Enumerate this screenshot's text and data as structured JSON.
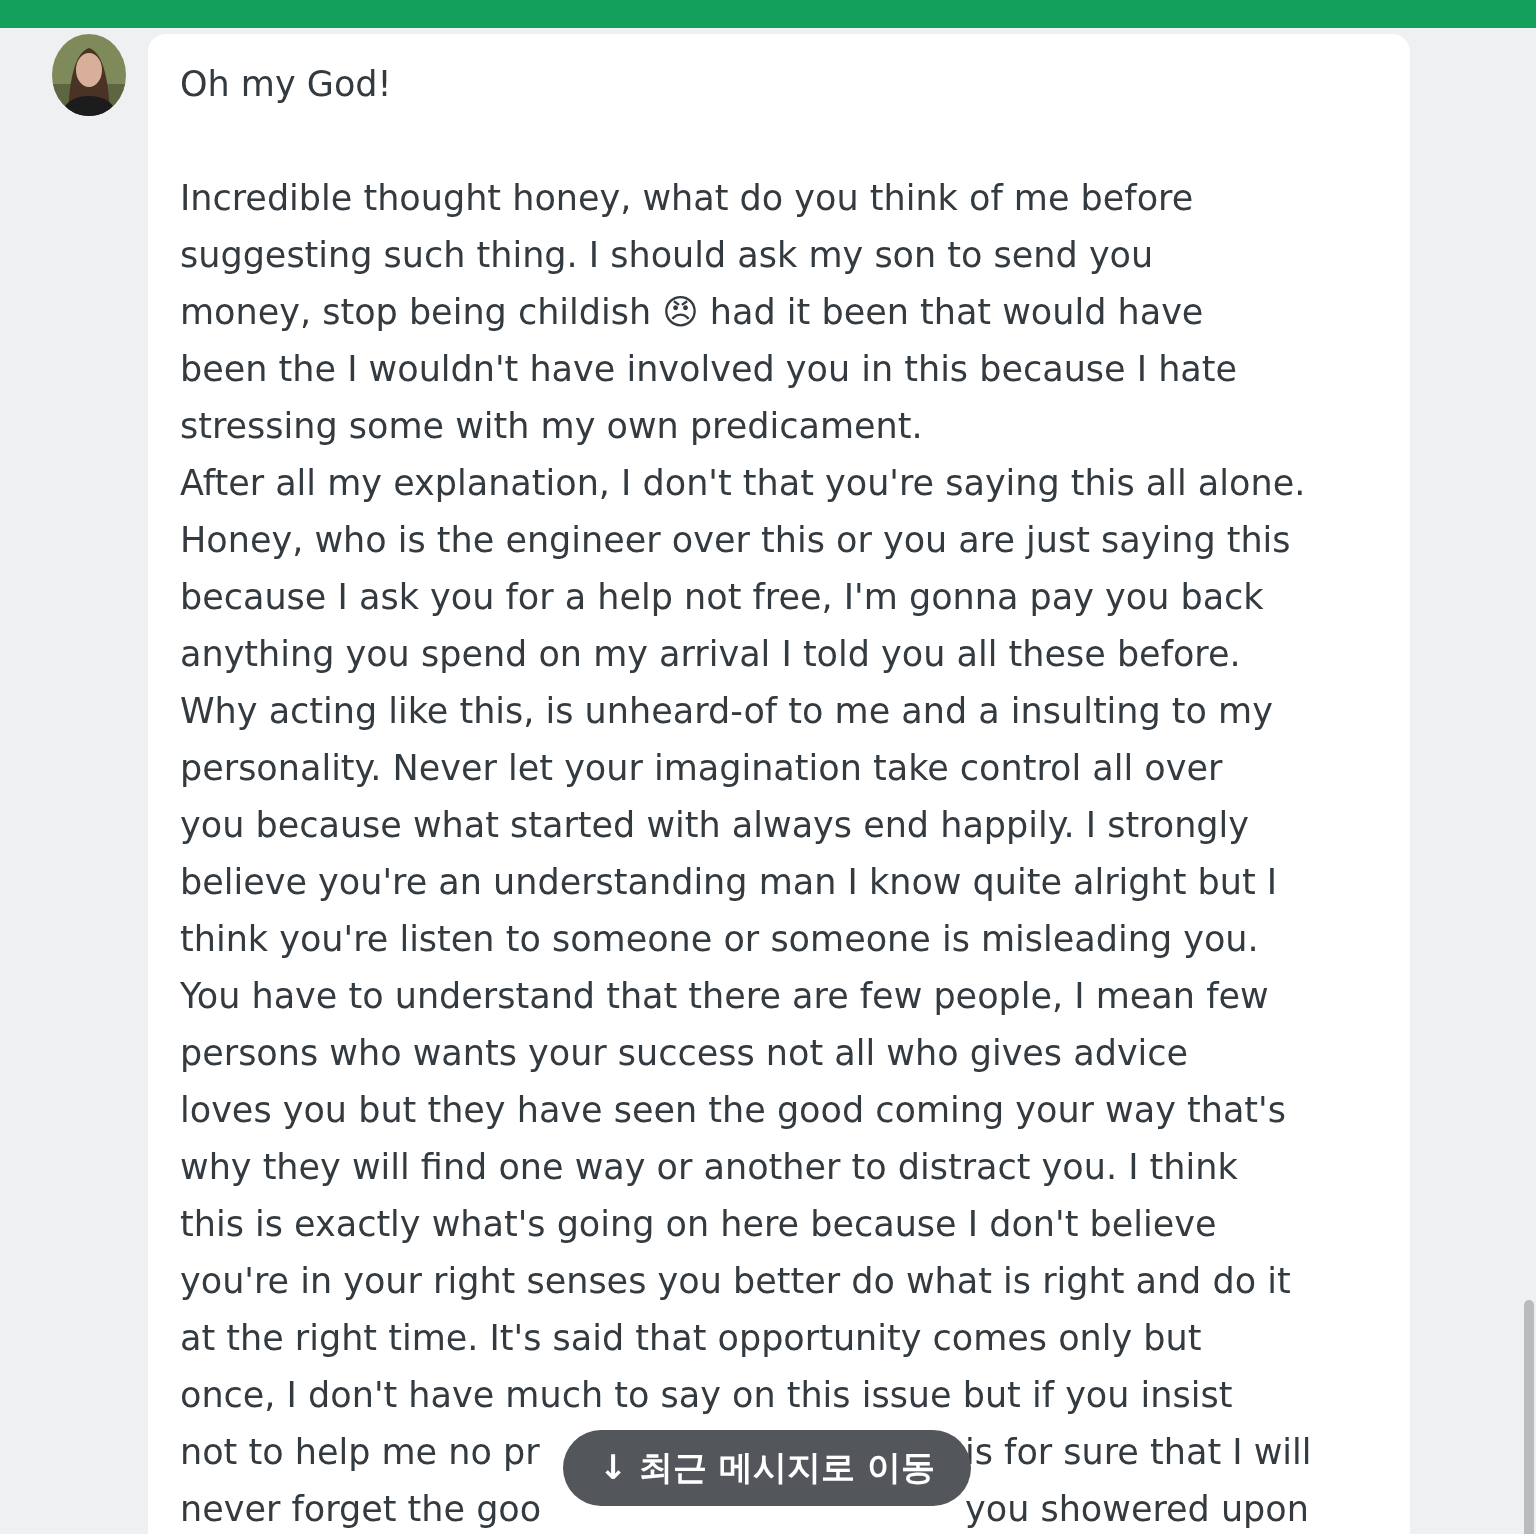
{
  "message": {
    "text": "Oh my God!\n\nIncredible thought honey, what do you think of me before\nsuggesting such thing. I should ask my son to send you\nmoney, stop being childish 😠 had it been that would have\nbeen the I wouldn't have involved you in this because I hate\nstressing some with my own predicament.\nAfter all my explanation, I don't that you're saying this all alone.\nHoney, who is the engineer over this or you are just saying this\nbecause I ask you for a help not free, I'm gonna pay you back\nanything you spend on my arrival I told you all these before.\nWhy acting like this, is unheard-of to me and a insulting to my\npersonality. Never let your imagination take control all over\nyou because what started with always end happily. I strongly\nbelieve you're an understanding man I know quite alright but I\nthink you're listen to someone or someone is misleading you.\nYou have to understand that there are few people, I mean few\npersons who wants your success not all who gives advice\nloves you but they have seen the good coming your way that's\nwhy they will find one way or another to distract you. I think\nthis is exactly what's going on here because I don't believe\nyou're in your right senses you better do what is right and do it\nat the right time. It's said that opportunity comes only but\nonce, I don't have much to say on this issue but if you insist",
    "covered_lines": [
      {
        "left": "not to help me no pr",
        "right": "is for sure that I will"
      },
      {
        "left": "never forget the goo",
        "right": "you showered upon"
      }
    ]
  },
  "jump_button": {
    "label": "↓ 최근 메시지로 이동"
  }
}
